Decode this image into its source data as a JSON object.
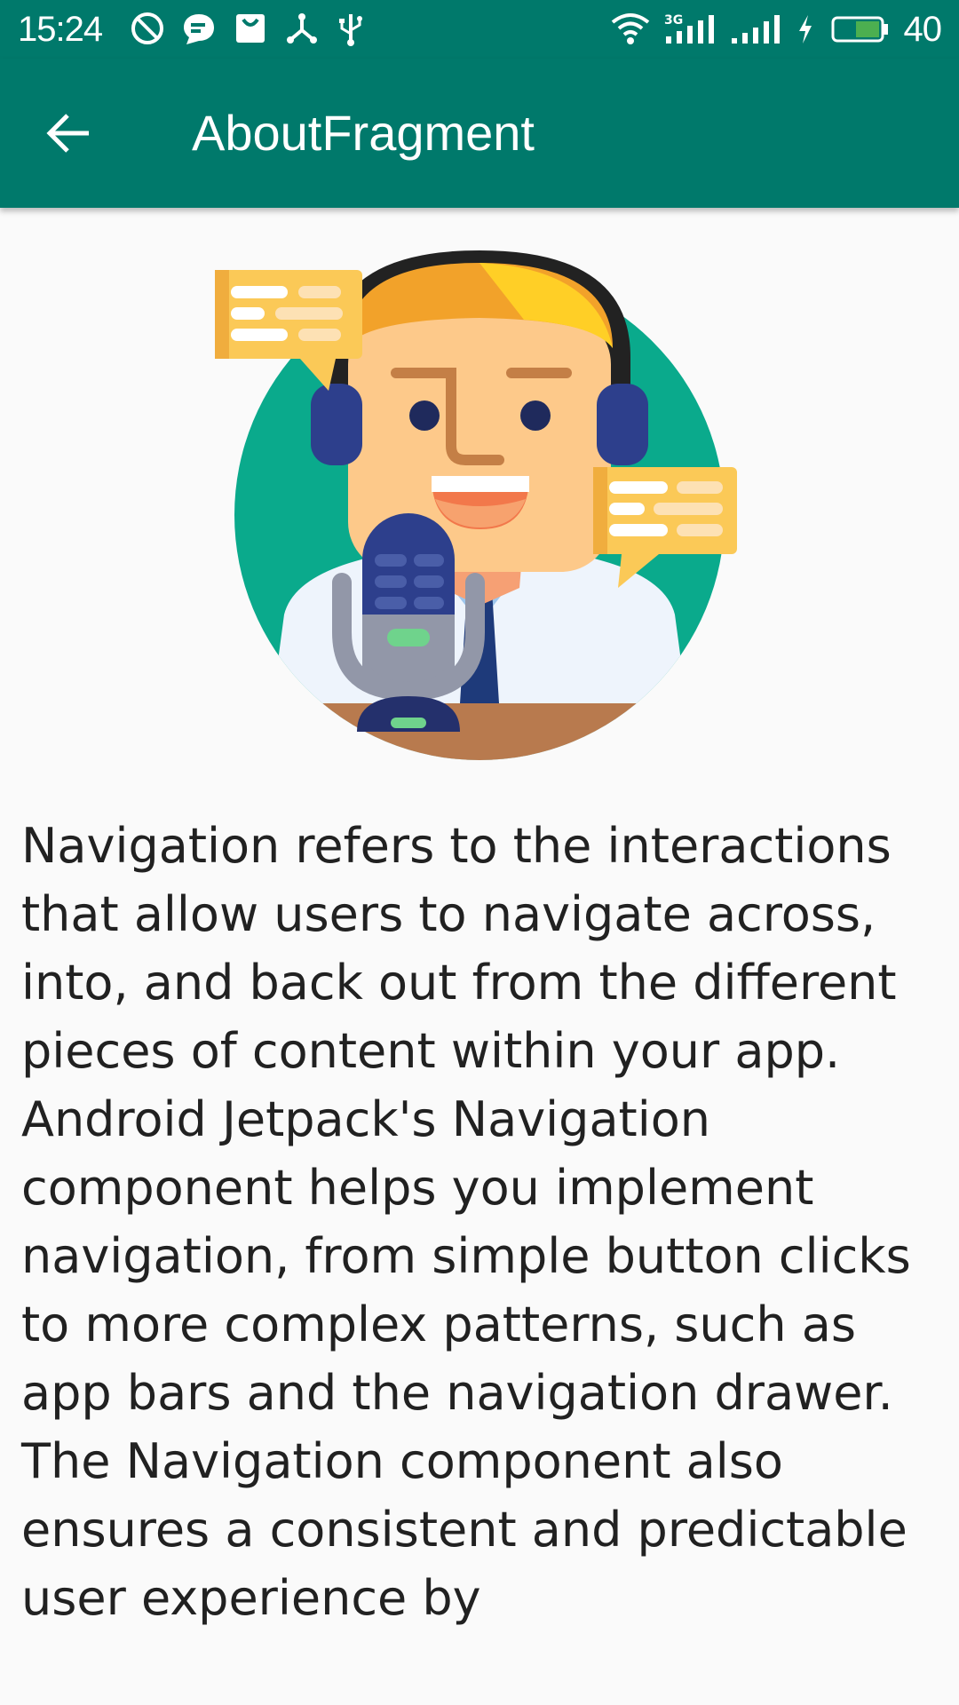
{
  "status_bar": {
    "time": "15:24",
    "battery_level": "40",
    "left_icons": [
      "do-not-disturb-icon",
      "chat-bubble-icon",
      "shopping-bag-icon",
      "share-network-icon",
      "usb-icon"
    ],
    "right_icons": [
      "wifi-icon",
      "signal-3g-icon",
      "signal-icon",
      "charging-bolt-icon",
      "battery-icon"
    ],
    "background_color": "#00796b"
  },
  "toolbar": {
    "title": "AboutFragment",
    "back_icon": "arrow-back-icon",
    "background_color": "#00796b"
  },
  "content": {
    "illustration_icon": "podcast-host-illustration",
    "body": "Navigation refers to the interactions that allow users to navigate across, into, and back out from the different pieces of content within your app. Android Jetpack's Navigation component helps you implement navigation, from simple button clicks to more complex patterns, such as app bars and the navigation drawer. The Navigation component also ensures a consistent and predictable user experience by"
  }
}
